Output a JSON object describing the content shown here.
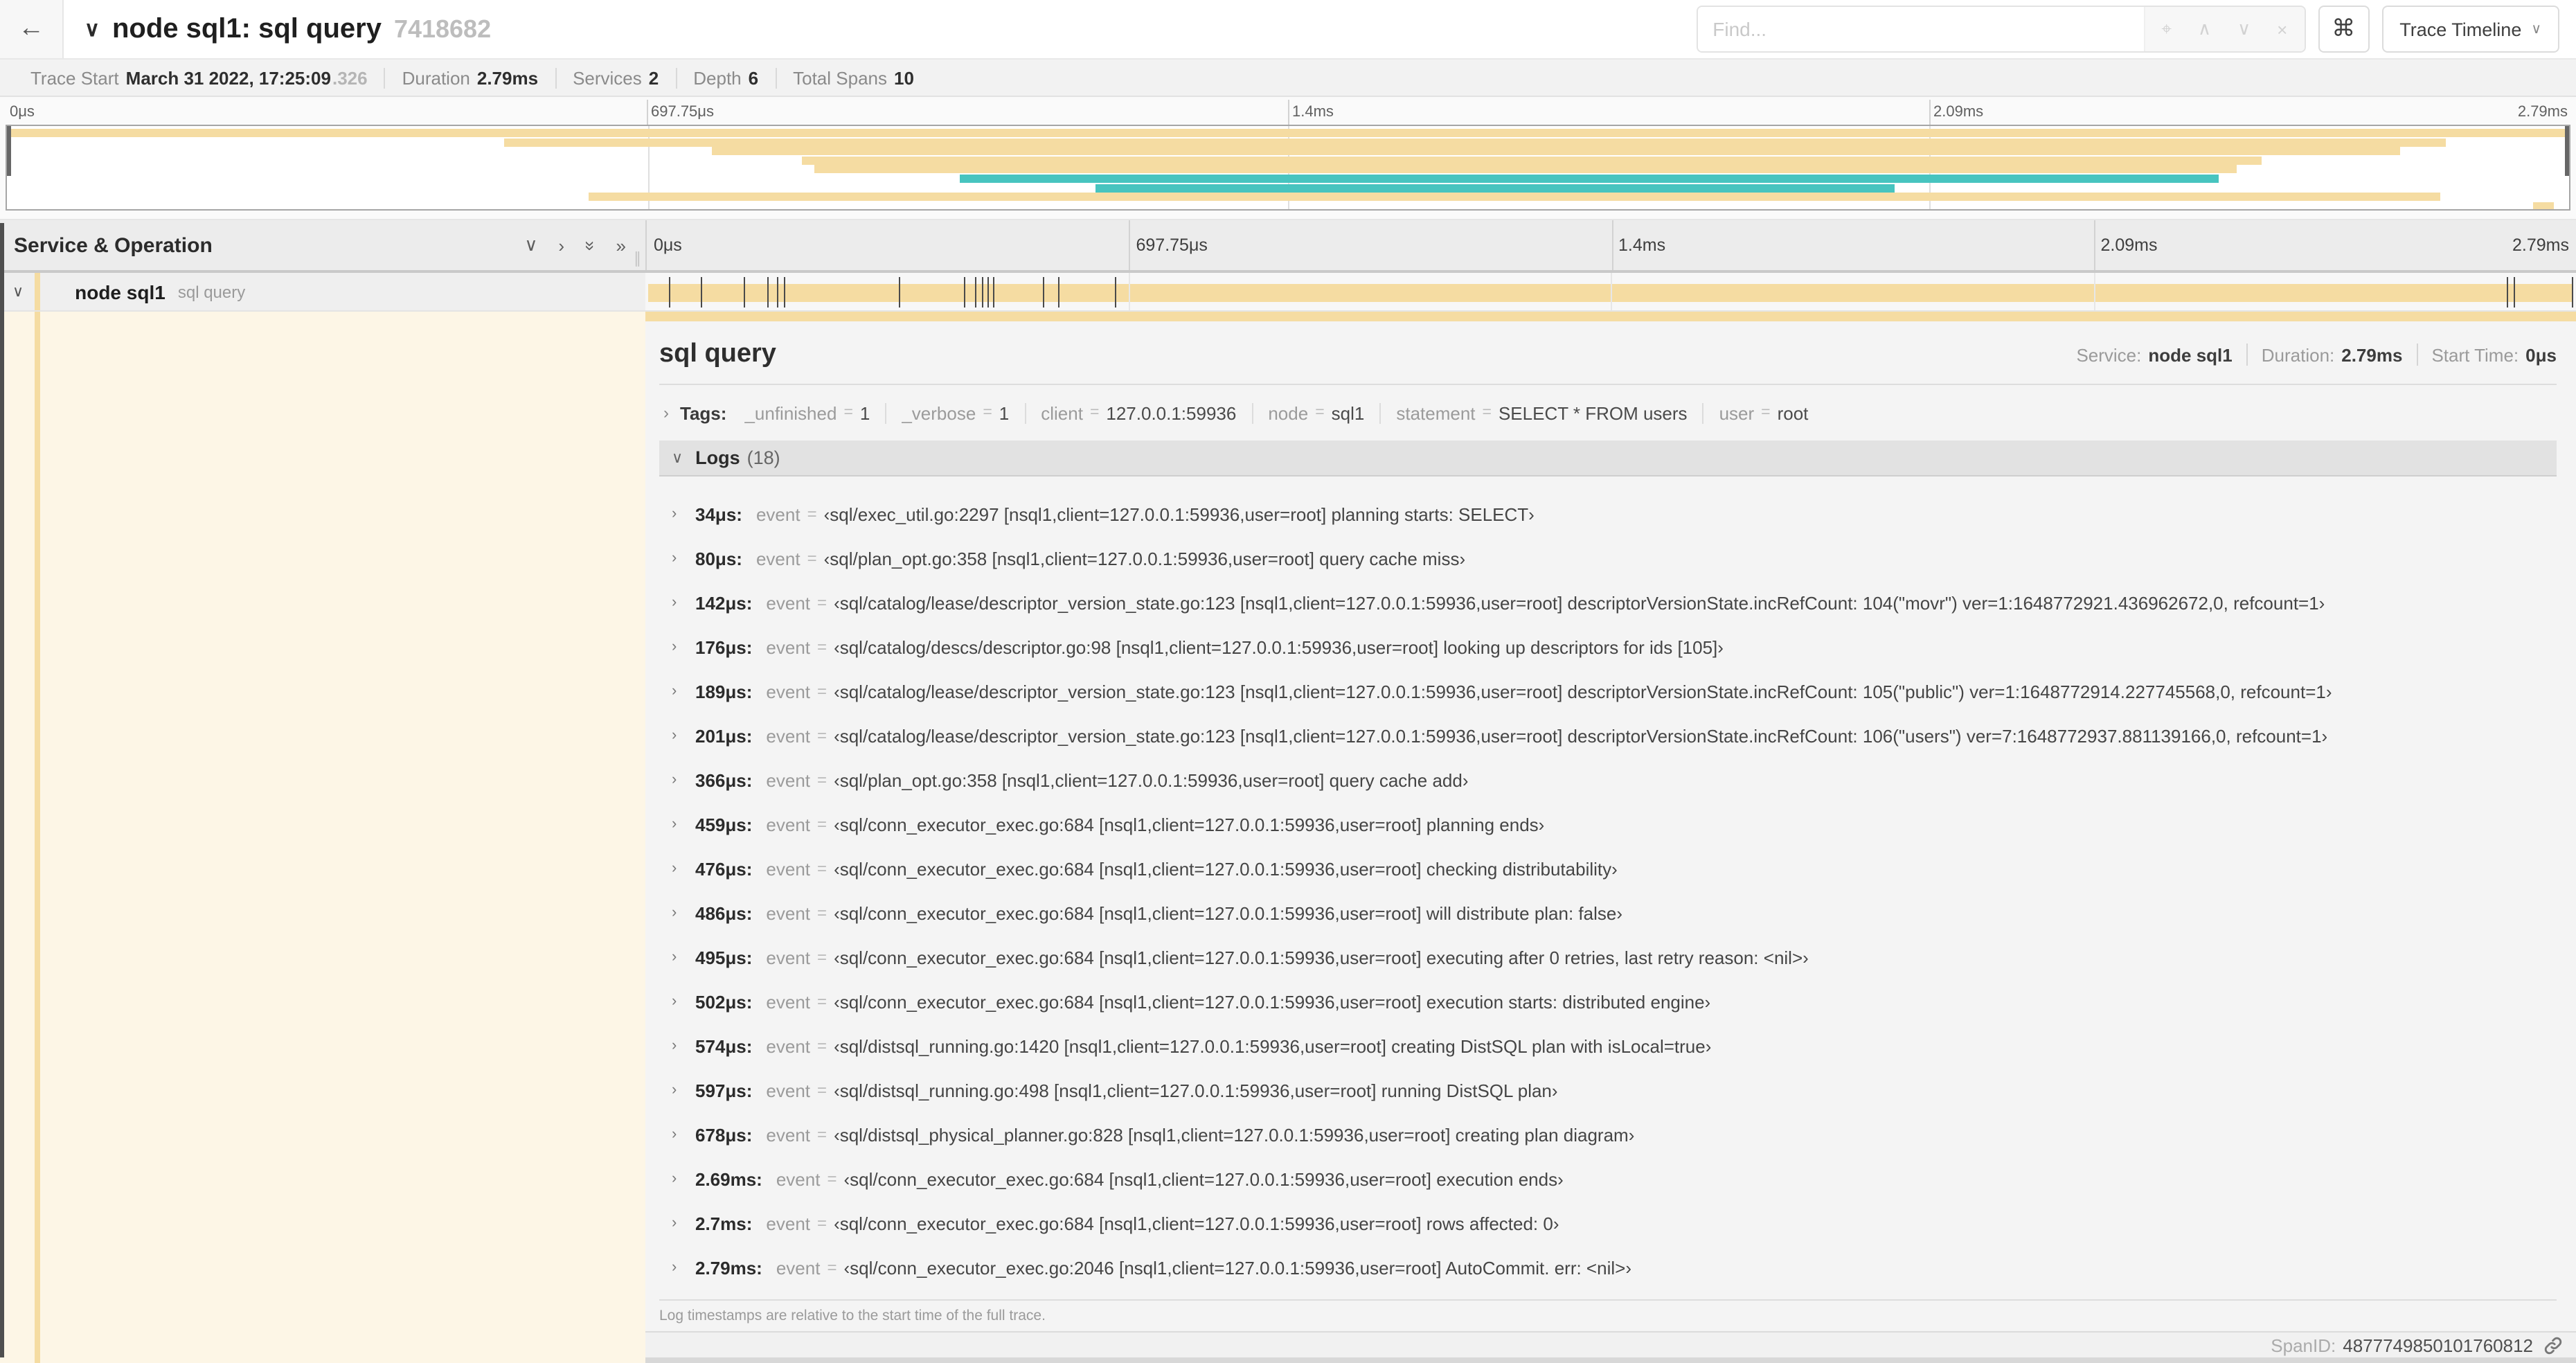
{
  "header": {
    "back_icon": "←",
    "collapse_icon": "∨",
    "title": "node sql1: sql query",
    "trace_id": "7418682",
    "find_placeholder": "Find...",
    "locate_icon": "⌖",
    "prev_icon": "∧",
    "next_icon": "∨",
    "clear_icon": "×",
    "shortcut_icon": "⌘",
    "view_button": "Trace Timeline",
    "view_dropdown_icon": "∨"
  },
  "summary": {
    "items": [
      {
        "label": "Trace Start",
        "value": "March 31 2022, 17:25:09",
        "suffix": ".326"
      },
      {
        "label": "Duration",
        "value": "2.79ms"
      },
      {
        "label": "Services",
        "value": "2"
      },
      {
        "label": "Depth",
        "value": "6"
      },
      {
        "label": "Total Spans",
        "value": "10"
      }
    ]
  },
  "colors": {
    "span_tan": "#F5DCA2",
    "span_teal": "#47C4BF",
    "detail_bg_cream": "#FDF6E6"
  },
  "timeline": {
    "ticks": [
      "0μs",
      "697.75μs",
      "1.4ms",
      "2.09ms",
      "2.79ms"
    ],
    "log_marker_positions_pct": [
      1.2,
      2.9,
      5.1,
      6.3,
      6.8,
      7.2,
      13.1,
      16.5,
      17.1,
      17.4,
      17.7,
      18.0,
      20.6,
      21.4,
      24.3,
      96.4,
      96.8,
      99.8
    ]
  },
  "minimap": {
    "rows": [
      {
        "start_pct": 0,
        "end_pct": 100,
        "color": "tan"
      },
      {
        "start_pct": 19.4,
        "end_pct": 95.2,
        "color": "tan"
      },
      {
        "start_pct": 27.5,
        "end_pct": 93.4,
        "color": "tan"
      },
      {
        "start_pct": 31.0,
        "end_pct": 88.0,
        "color": "tan"
      },
      {
        "start_pct": 31.5,
        "end_pct": 87.0,
        "color": "tan"
      },
      {
        "start_pct": 37.2,
        "end_pct": 86.3,
        "color": "teal"
      },
      {
        "start_pct": 42.5,
        "end_pct": 73.7,
        "color": "teal"
      },
      {
        "start_pct": 22.7,
        "end_pct": 95.0,
        "color": "tan"
      },
      {
        "start_pct": 98.6,
        "end_pct": 99.4,
        "color": "tan"
      }
    ]
  },
  "left_panel": {
    "title": "Service & Operation",
    "collapse_down_icon": "∨",
    "collapse_right_icon": "›",
    "double_chevron_icon": "»",
    "grip_icon": "∥",
    "row": {
      "chevron": "∨",
      "service": "node sql1",
      "operation": "sql query"
    }
  },
  "detail": {
    "title": "sql query",
    "meta": [
      {
        "label": "Service:",
        "value": "node sql1"
      },
      {
        "label": "Duration:",
        "value": "2.79ms"
      },
      {
        "label": "Start Time:",
        "value": "0μs"
      }
    ],
    "tags_chevron": "›",
    "tags_label": "Tags:",
    "tags": [
      {
        "key": "_unfinished",
        "value": "1"
      },
      {
        "key": "_verbose",
        "value": "1"
      },
      {
        "key": "client",
        "value": "127.0.0.1:59936"
      },
      {
        "key": "node",
        "value": "sql1"
      },
      {
        "key": "statement",
        "value": "SELECT * FROM users"
      },
      {
        "key": "user",
        "value": "root"
      }
    ],
    "logs_chevron": "∨",
    "logs_label": "Logs",
    "logs_count": "(18)",
    "log_key": "event",
    "log_eq": "=",
    "logs": [
      {
        "ts": "34μs:",
        "value": "‹sql/exec_util.go:2297 [nsql1,client=127.0.0.1:59936,user=root] planning starts: SELECT›"
      },
      {
        "ts": "80μs:",
        "value": "‹sql/plan_opt.go:358 [nsql1,client=127.0.0.1:59936,user=root] query cache miss›"
      },
      {
        "ts": "142μs:",
        "value": "‹sql/catalog/lease/descriptor_version_state.go:123 [nsql1,client=127.0.0.1:59936,user=root] descriptorVersionState.incRefCount: 104(\"movr\") ver=1:1648772921.436962672,0, refcount=1›"
      },
      {
        "ts": "176μs:",
        "value": "‹sql/catalog/descs/descriptor.go:98 [nsql1,client=127.0.0.1:59936,user=root] looking up descriptors for ids [105]›"
      },
      {
        "ts": "189μs:",
        "value": "‹sql/catalog/lease/descriptor_version_state.go:123 [nsql1,client=127.0.0.1:59936,user=root] descriptorVersionState.incRefCount: 105(\"public\") ver=1:1648772914.227745568,0, refcount=1›"
      },
      {
        "ts": "201μs:",
        "value": "‹sql/catalog/lease/descriptor_version_state.go:123 [nsql1,client=127.0.0.1:59936,user=root] descriptorVersionState.incRefCount: 106(\"users\") ver=7:1648772937.881139166,0, refcount=1›"
      },
      {
        "ts": "366μs:",
        "value": "‹sql/plan_opt.go:358 [nsql1,client=127.0.0.1:59936,user=root] query cache add›"
      },
      {
        "ts": "459μs:",
        "value": "‹sql/conn_executor_exec.go:684 [nsql1,client=127.0.0.1:59936,user=root] planning ends›"
      },
      {
        "ts": "476μs:",
        "value": "‹sql/conn_executor_exec.go:684 [nsql1,client=127.0.0.1:59936,user=root] checking distributability›"
      },
      {
        "ts": "486μs:",
        "value": "‹sql/conn_executor_exec.go:684 [nsql1,client=127.0.0.1:59936,user=root] will distribute plan: false›"
      },
      {
        "ts": "495μs:",
        "value": "‹sql/conn_executor_exec.go:684 [nsql1,client=127.0.0.1:59936,user=root] executing after 0 retries, last retry reason: <nil>›"
      },
      {
        "ts": "502μs:",
        "value": "‹sql/conn_executor_exec.go:684 [nsql1,client=127.0.0.1:59936,user=root] execution starts: distributed engine›"
      },
      {
        "ts": "574μs:",
        "value": "‹sql/distsql_running.go:1420 [nsql1,client=127.0.0.1:59936,user=root] creating DistSQL plan with isLocal=true›"
      },
      {
        "ts": "597μs:",
        "value": "‹sql/distsql_running.go:498 [nsql1,client=127.0.0.1:59936,user=root] running DistSQL plan›"
      },
      {
        "ts": "678μs:",
        "value": "‹sql/distsql_physical_planner.go:828 [nsql1,client=127.0.0.1:59936,user=root] creating plan diagram›"
      },
      {
        "ts": "2.69ms:",
        "value": "‹sql/conn_executor_exec.go:684 [nsql1,client=127.0.0.1:59936,user=root] execution ends›"
      },
      {
        "ts": "2.7ms:",
        "value": "‹sql/conn_executor_exec.go:684 [nsql1,client=127.0.0.1:59936,user=root] rows affected: 0›"
      },
      {
        "ts": "2.79ms:",
        "value": "‹sql/conn_executor_exec.go:2046 [nsql1,client=127.0.0.1:59936,user=root] AutoCommit. err: <nil>›"
      }
    ],
    "footer_note": "Log timestamps are relative to the start time of the full trace.",
    "spanid_label": "SpanID:",
    "spanid_value": "4877749850101760812"
  }
}
